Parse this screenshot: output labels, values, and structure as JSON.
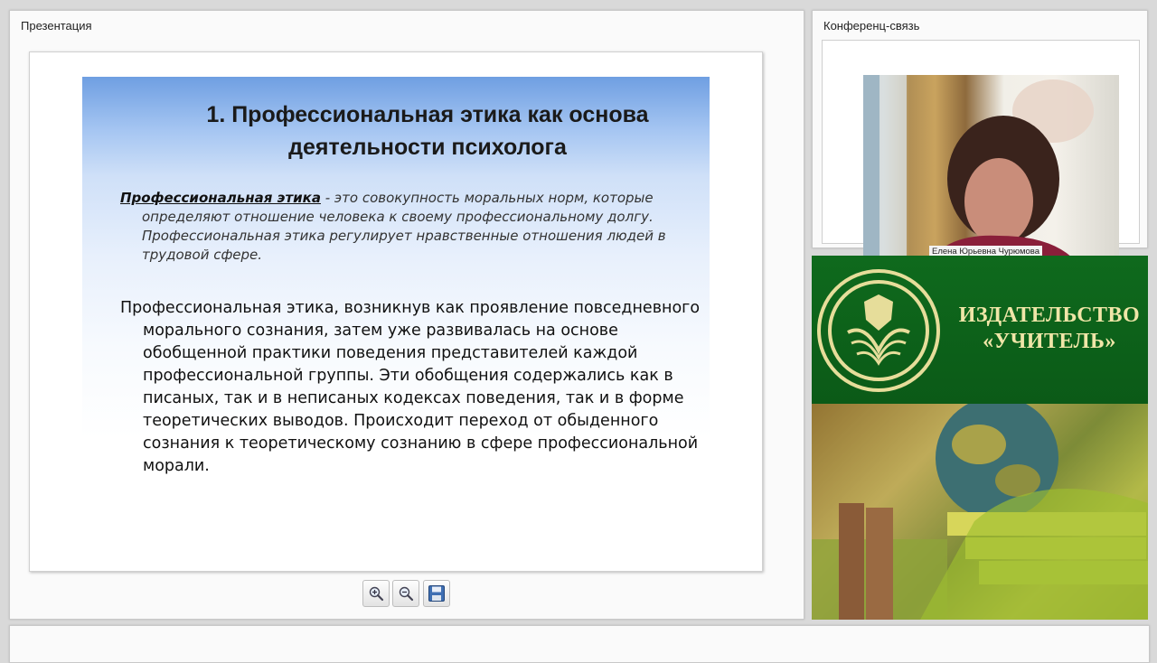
{
  "presentation_panel": {
    "title": "Презентация",
    "slide": {
      "title": "1. Профессиональная этика как основа деятельности психолога",
      "definition_term": "Профессиональная этика",
      "definition_text": " - это совокупность моральных норм, которые определяют отношение человека к своему профессиональному долгу. Профессиональная этика регулирует нравственные отношения людей в трудовой сфере.",
      "body_text": "Профессиональная этика, возникнув как проявление повседневного морального сознания, затем уже развивалась на основе обобщенной практики поведения представителей каждой профессиональной группы. Эти обобщения содержались как в писаных, так и в неписаных кодексах поведения, так и в форме теоретических выводов. Происходит переход от обыденного сознания к теоретическому сознанию в сфере профессиональной морали."
    },
    "toolbar": {
      "buttons": [
        {
          "icon": "zoom-in-icon"
        },
        {
          "icon": "zoom-out-icon"
        },
        {
          "icon": "save-icon"
        }
      ]
    }
  },
  "conference_panel": {
    "title": "Конференц-связь",
    "participant_name": "Елена Юрьевна Чурюмова"
  },
  "banner": {
    "publisher_line1": "ИЗДАТЕЛЬСТВО",
    "publisher_line2": "«УЧИТЕЛЬ»",
    "colors": {
      "green": "#0f6a1d",
      "gold": "#f0e6a8"
    }
  }
}
